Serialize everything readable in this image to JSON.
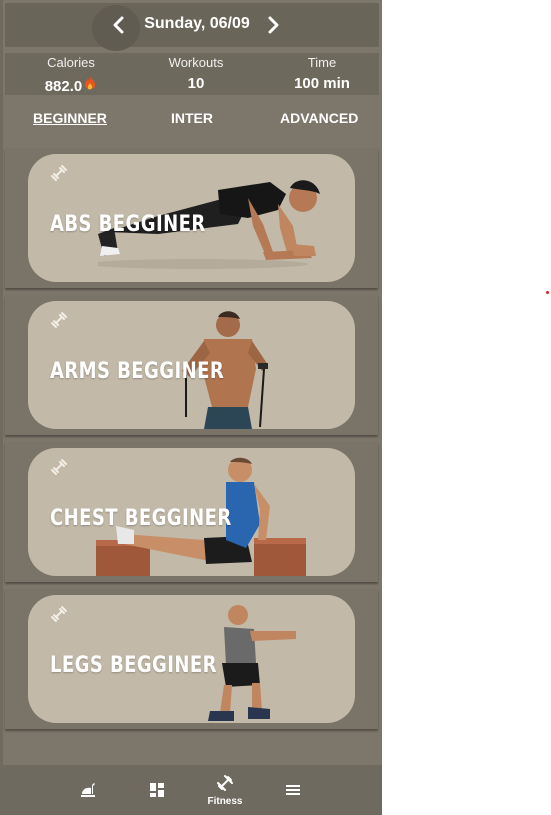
{
  "header": {
    "date": "Sunday, 06/09",
    "prev_icon": "chevron-left-icon",
    "next_icon": "chevron-right-icon"
  },
  "stats": {
    "calories_label": "Calories",
    "calories_value": "882.0",
    "calories_icon": "flame-icon",
    "workouts_label": "Workouts",
    "workouts_value": "10",
    "time_label": "Time",
    "time_value": "100 min"
  },
  "tabs": [
    {
      "label": "BEGINNER",
      "selected": true
    },
    {
      "label": "INTER",
      "selected": false
    },
    {
      "label": "ADVANCED",
      "selected": false
    }
  ],
  "cards": [
    {
      "title": "ABS BEGGINER",
      "icon": "dumbbell-icon"
    },
    {
      "title": "ARMS BEGGINER",
      "icon": "dumbbell-icon"
    },
    {
      "title": "CHEST BEGGINER",
      "icon": "dumbbell-icon"
    },
    {
      "title": "LEGS BEGGINER",
      "icon": "dumbbell-icon"
    }
  ],
  "bottom_nav": [
    {
      "icon": "food-icon",
      "label": ""
    },
    {
      "icon": "dashboard-icon",
      "label": ""
    },
    {
      "icon": "fitness-icon",
      "label": "Fitness",
      "active": true
    },
    {
      "icon": "menu-icon",
      "label": ""
    }
  ],
  "colors": {
    "background": "#7d776b",
    "card": "#c2b9a8",
    "header": "#6a6559",
    "text": "#ffffff"
  }
}
